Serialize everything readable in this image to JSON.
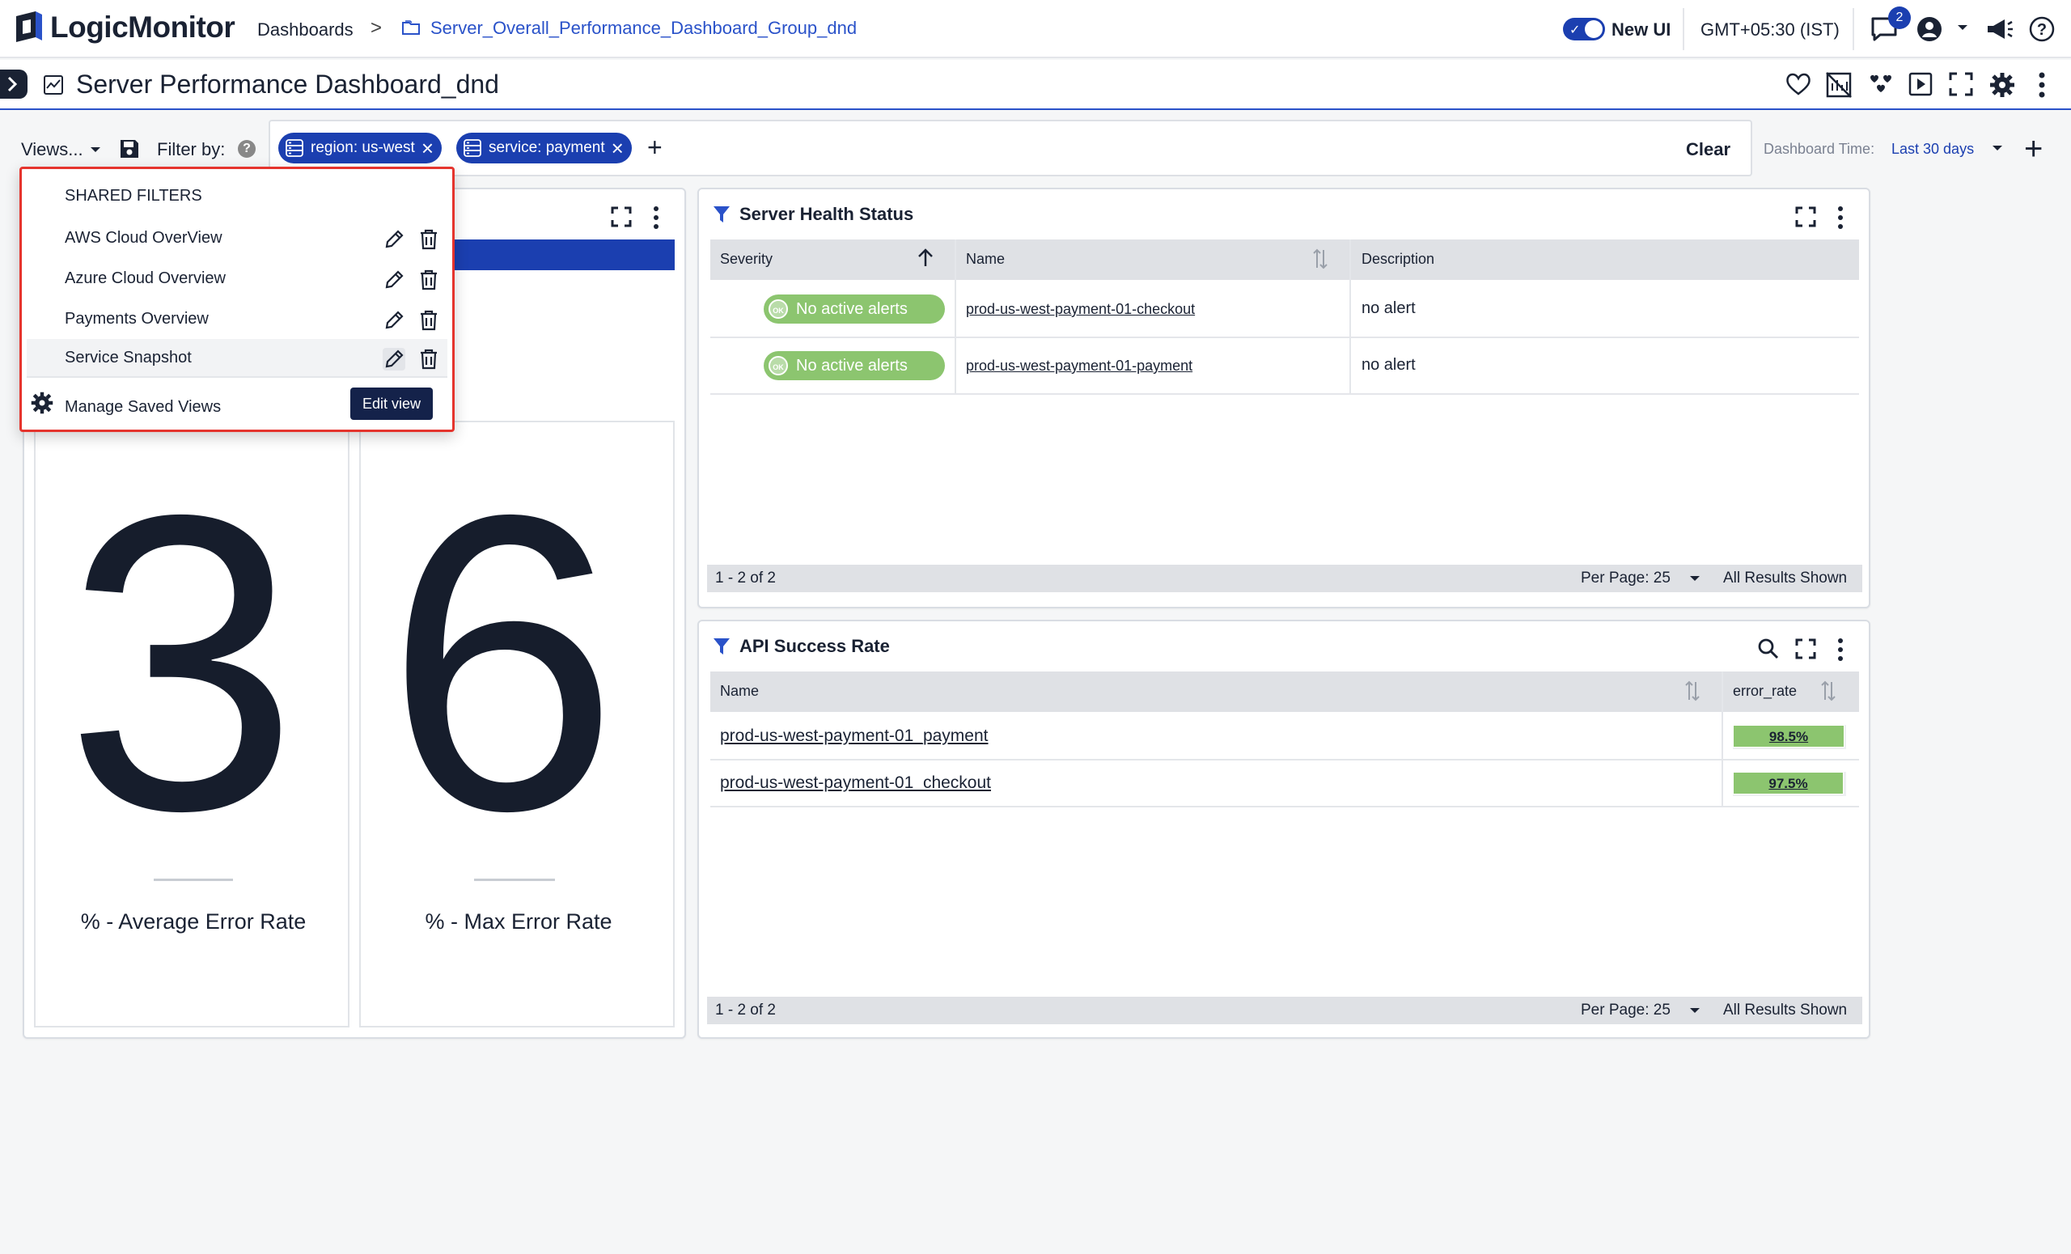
{
  "header": {
    "brand": "LogicMonitor",
    "breadcrumb_root": "Dashboards",
    "breadcrumb_sep": ">",
    "breadcrumb_group": "Server_Overall_Performance_Dashboard_Group_dnd",
    "new_ui_label": "New UI",
    "timezone": "GMT+05:30 (IST)",
    "notification_count": "2",
    "accent_color": "#1b3fb0"
  },
  "title_bar": {
    "title": "Server Performance Dashboard_dnd",
    "icons": [
      "heart-icon",
      "no-chart-icon",
      "hearts-icon",
      "play-icon",
      "fullscreen-icon",
      "gear-icon",
      "more-icon"
    ]
  },
  "filter_bar": {
    "views_label": "Views...",
    "filter_by_label": "Filter by:",
    "help": "?",
    "chips": [
      {
        "label": "region: us-west"
      },
      {
        "label": "service: payment"
      }
    ],
    "add": "+",
    "clear_label": "Clear",
    "dashboard_time_label": "Dashboard Time:",
    "dashboard_time_value": "Last 30 days",
    "add_widget": "+"
  },
  "views_menu": {
    "header": "SHARED FILTERS",
    "items": [
      {
        "label": "AWS Cloud OverView"
      },
      {
        "label": "Azure Cloud Overview"
      },
      {
        "label": "Payments Overview"
      },
      {
        "label": "Service Snapshot"
      }
    ],
    "manage_label": "Manage Saved Views",
    "edit_view_label": "Edit view"
  },
  "big_numbers": [
    {
      "value": "3",
      "label": "% - Average Error Rate"
    },
    {
      "value": "6",
      "label": "% - Max Error Rate"
    }
  ],
  "server_health": {
    "title": "Server Health Status",
    "columns": [
      "Severity",
      "Name",
      "Description"
    ],
    "rows": [
      {
        "severity": "No active alerts",
        "badge": "OK",
        "name": "prod-us-west-payment-01-checkout",
        "description": "no alert"
      },
      {
        "severity": "No active alerts",
        "badge": "OK",
        "name": "prod-us-west-payment-01-payment",
        "description": "no alert"
      }
    ],
    "footer_range": "1 - 2 of 2",
    "per_page": "Per Page: 25",
    "results": "All Results Shown"
  },
  "api_success": {
    "title": "API Success Rate",
    "columns": [
      "Name",
      "error_rate"
    ],
    "rows": [
      {
        "name": "prod-us-west-payment-01_payment",
        "rate": "98.5%",
        "fill": 0.985
      },
      {
        "name": "prod-us-west-payment-01_checkout",
        "rate": "97.5%",
        "fill": 0.975
      }
    ],
    "footer_range": "1 - 2 of 2",
    "per_page": "Per Page: 25",
    "results": "All Results Shown"
  },
  "colors": {
    "ok_green": "#8cc56f",
    "highlight_blue": "#1b3fb0",
    "menu_border_red": "#e5342d"
  }
}
